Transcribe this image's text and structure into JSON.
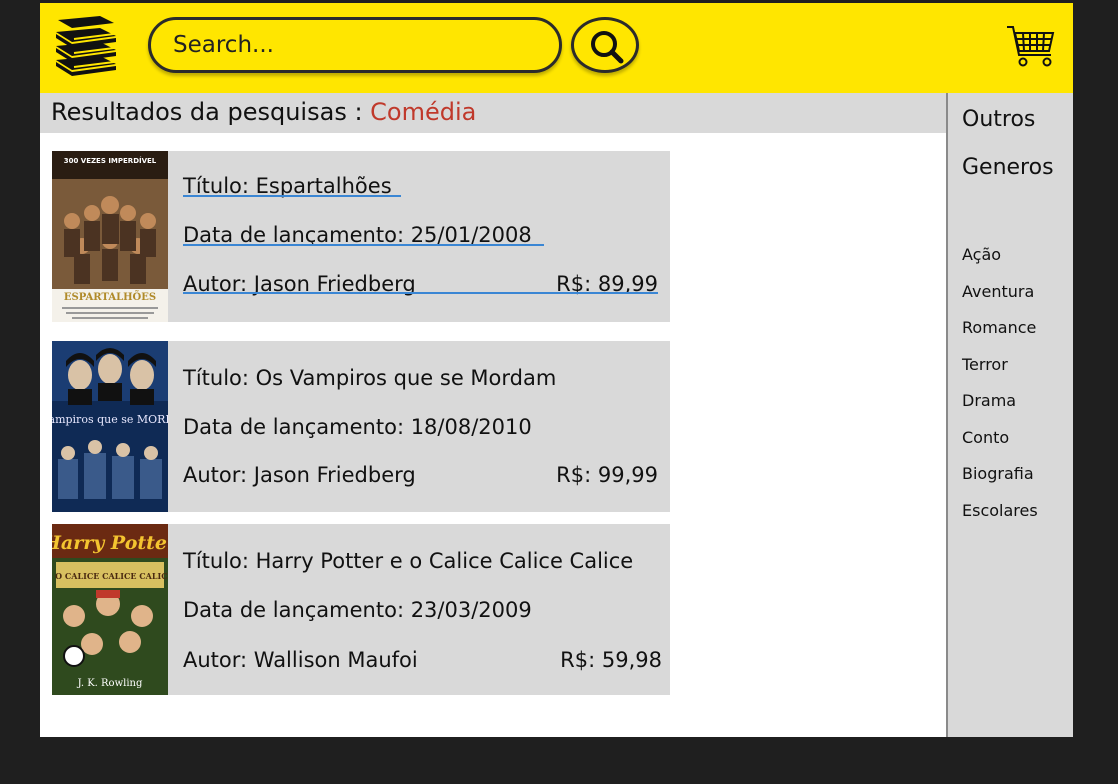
{
  "header": {
    "logo_icon": "books-stack-icon",
    "search": {
      "placeholder": "Search...",
      "value": "Search..."
    },
    "search_button_icon": "magnifier-icon",
    "cart_icon": "shopping-cart-icon",
    "accent_color": "#ffe600"
  },
  "results": {
    "label": "Resultados da pesquisas : ",
    "term": "Comédia",
    "term_color": "#c0392b"
  },
  "sidebar": {
    "title_line1": "Outros",
    "title_line2": "Generos",
    "genres": [
      "Ação",
      "Aventura",
      "Romance",
      "Terror",
      "Drama",
      "Conto",
      "Biografia",
      "Escolares"
    ]
  },
  "books": [
    {
      "title": "Título: Espartalhões",
      "date": "Data de lançamento: 25/01/2008",
      "author": "Autor: Jason Friedberg",
      "price": "R$: 89,99",
      "poster_caption": "ESPARTALHÕES",
      "poster_tagline": "300 VEZES IMPERDÍVEL"
    },
    {
      "title": "Título: Os Vampiros que se Mordam",
      "date": "Data de lançamento: 18/08/2010",
      "author": "Autor: Jason Friedberg",
      "price": "R$: 99,99",
      "poster_caption": "os vampiros que se MORDAM"
    },
    {
      "title": "Título: Harry Potter e o Calice Calice Calice",
      "date": "Data de lançamento: 23/03/2009",
      "author": "Autor: Wallison Maufoi",
      "price": "R$: 59,98",
      "poster_caption": "Harry Potter",
      "poster_sub": "E O CALICE CALICE CALICE",
      "poster_author": "J. K. Rowling"
    }
  ]
}
